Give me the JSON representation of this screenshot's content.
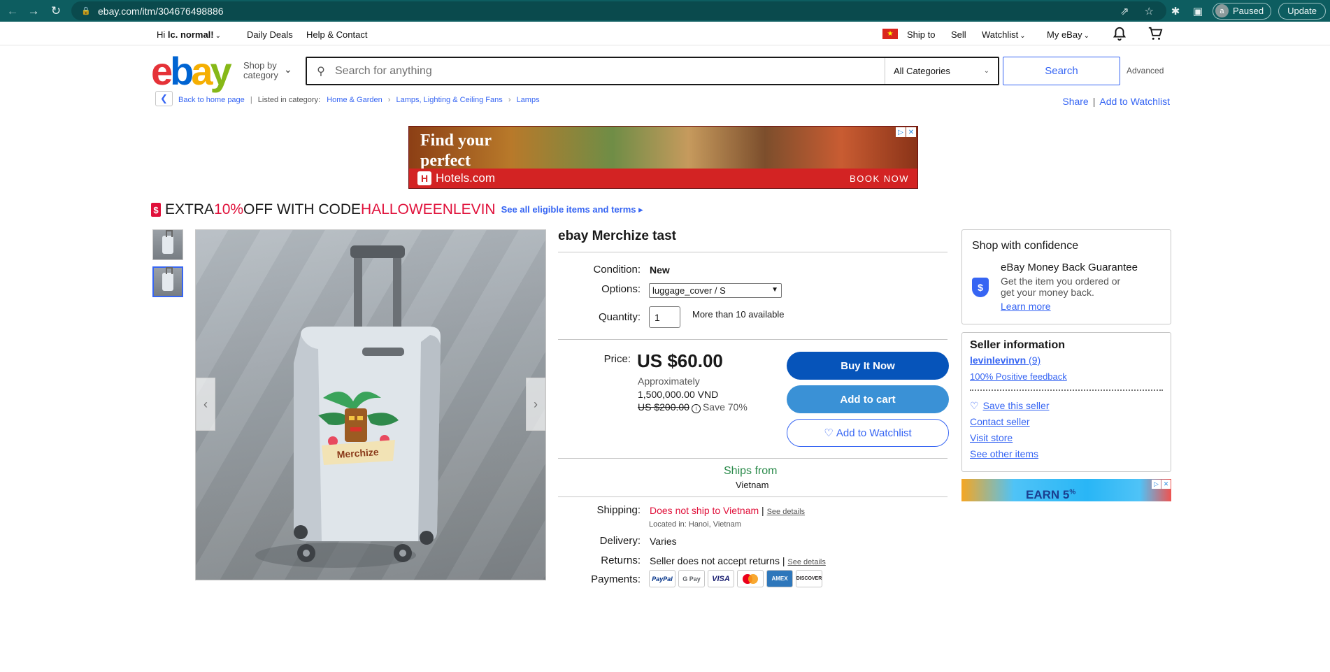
{
  "browser": {
    "url": "ebay.com/itm/304676498886",
    "profile_initial": "a",
    "profile_status": "Paused",
    "update_label": "Update"
  },
  "topnav": {
    "greeting_prefix": "Hi ",
    "greeting_name": "lc. normal!",
    "daily_deals": "Daily Deals",
    "help": "Help & Contact",
    "ship_to": "Ship to",
    "sell": "Sell",
    "watchlist": "Watchlist",
    "my_ebay": "My eBay"
  },
  "header": {
    "logo": {
      "e": "e",
      "b": "b",
      "a": "a",
      "y": "y"
    },
    "shop_by_line1": "Shop by",
    "shop_by_line2": "category",
    "search_placeholder": "Search for anything",
    "category": "All Categories",
    "search_button": "Search",
    "advanced": "Advanced"
  },
  "breadcrumb": {
    "back": "Back to home page",
    "listed_in": "Listed in category:",
    "items": [
      "Home & Garden",
      "Lamps, Lighting & Ceiling Fans",
      "Lamps"
    ],
    "share": "Share",
    "add_to_watchlist": "Add to Watchlist"
  },
  "ad": {
    "line1": "Find your",
    "line2": "perfect",
    "brand": "Hotels.com",
    "cta": "BOOK NOW"
  },
  "promo": {
    "text1": "EXTRA ",
    "percent": "10%",
    "text2": " OFF WITH CODE ",
    "code": "HALLOWEENLEVIN",
    "link": "See all eligible items and terms"
  },
  "item": {
    "title": "ebay Merchize tast",
    "condition_label": "Condition:",
    "condition_value": "New",
    "options_label": "Options:",
    "options_value": "luggage_cover / S",
    "quantity_label": "Quantity:",
    "quantity_value": "1",
    "available": "More than 10 available",
    "price_label": "Price:",
    "price": "US $60.00",
    "approx_label": "Approximately",
    "approx_value": "1,500,000.00 VND",
    "original_price": "US $200.00",
    "save": "Save 70%",
    "buy_now": "Buy It Now",
    "add_to_cart": "Add to cart",
    "add_to_watchlist": "Add to Watchlist",
    "ships_from": "Ships from",
    "ships_from_country": "Vietnam",
    "shipping_label": "Shipping:",
    "shipping_value": "Does not ship to Vietnam",
    "see_details": "See details",
    "located": "Located in: Hanoi, Vietnam",
    "delivery_label": "Delivery:",
    "delivery_value": "Varies",
    "returns_label": "Returns:",
    "returns_value": "Seller does not accept returns",
    "payments_label": "Payments:",
    "payment_methods": [
      "PayPal",
      "G Pay",
      "VISA",
      "Mastercard",
      "AMEX",
      "DISCOVER"
    ]
  },
  "confidence": {
    "title": "Shop with confidence",
    "guarantee_title": "eBay Money Back Guarantee",
    "guarantee_desc": "Get the item you ordered or get your money back.",
    "learn_more": "Learn more"
  },
  "seller": {
    "title": "Seller information",
    "name": "levinlevinvn",
    "feedback_count": "(9)",
    "positive": "100% Positive feedback",
    "save_seller": "Save this seller",
    "contact": "Contact seller",
    "visit_store": "Visit store",
    "other_items": "See other items"
  },
  "ad2": {
    "text": "EARN 5",
    "superscript": "%"
  },
  "colors": {
    "brand_blue": "#3665f3",
    "buy_button": "#0654ba",
    "cart_button": "#3a91d6",
    "alert_red": "#e0103a",
    "ships_green": "#2a8a4a",
    "browser_frame": "#0d5d60"
  }
}
